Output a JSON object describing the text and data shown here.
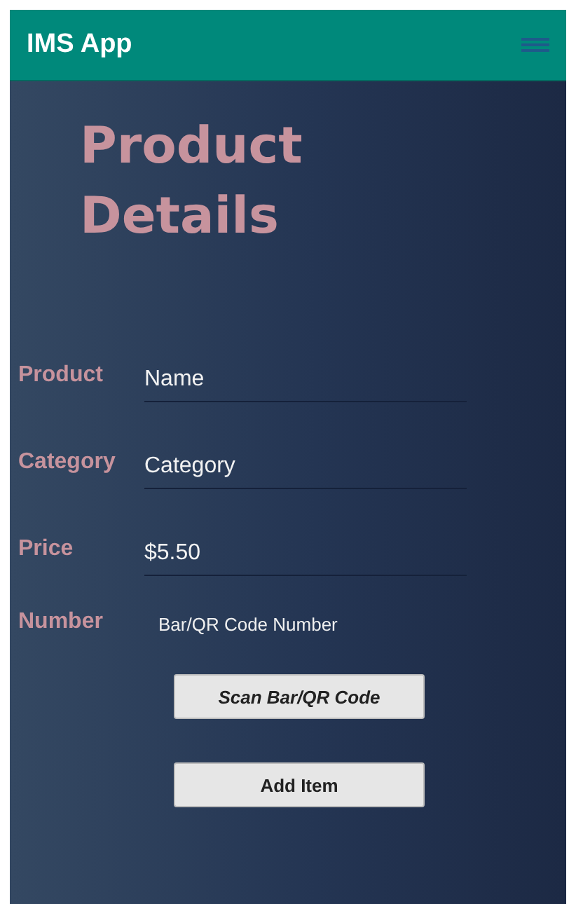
{
  "app_bar": {
    "title": "IMS App"
  },
  "heading": "Product Details",
  "fields": [
    {
      "label": "Product",
      "kind": "input",
      "placeholder": "Name"
    },
    {
      "label": "Category",
      "kind": "input",
      "placeholder": "Category"
    },
    {
      "label": "Price",
      "kind": "input",
      "value": "$5.50"
    },
    {
      "label": "Number",
      "kind": "readout",
      "value": "Bar/QR Code Number"
    }
  ],
  "buttons": [
    {
      "label": "Scan Bar/QR Code",
      "kind": "scan"
    },
    {
      "label": "Add Item",
      "kind": "add"
    }
  ]
}
